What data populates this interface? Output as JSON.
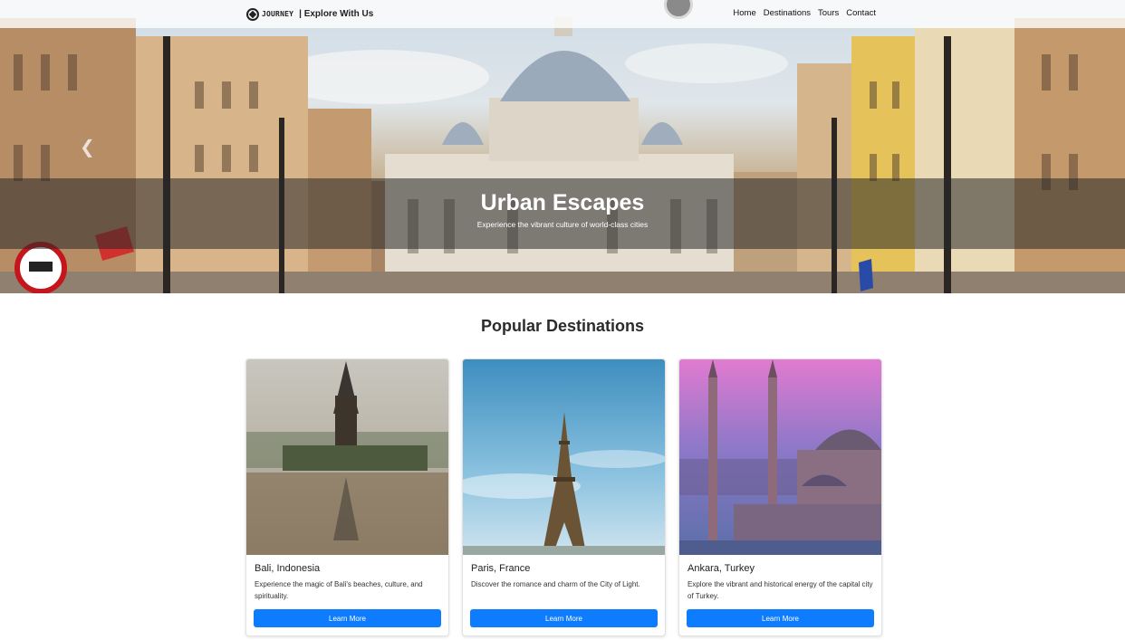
{
  "navbar": {
    "brand_name": "JOURNEY",
    "brand_tagline": "| Explore With Us",
    "links": [
      "Home",
      "Destinations",
      "Tours",
      "Contact"
    ]
  },
  "hero": {
    "title": "Urban Escapes",
    "subtitle": "Experience the vibrant culture of world-class cities",
    "prev_icon": "chevron-left-icon"
  },
  "destinations": {
    "heading": "Popular Destinations",
    "cards": [
      {
        "title": "Bali, Indonesia",
        "text": "Experience the magic of Bali's beaches, culture, and spirituality.",
        "button": "Learn More"
      },
      {
        "title": "Paris, France",
        "text": "Discover the romance and charm of the City of Light.",
        "button": "Learn More"
      },
      {
        "title": "Ankara, Turkey",
        "text": "Explore the vibrant and historical energy of the capital city of Turkey.",
        "button": "Learn More"
      }
    ]
  },
  "colors": {
    "accent": "#0d7cff",
    "caption_bg": "#282828"
  }
}
